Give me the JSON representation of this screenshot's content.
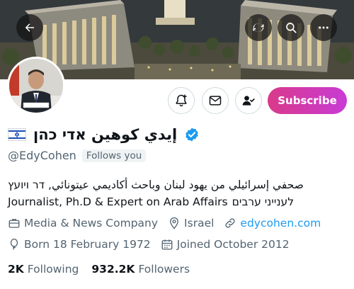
{
  "profile": {
    "display_name": "إيدي كوهين אדי כהן",
    "handle": "@EdyCohen",
    "follows_you": "Follows you",
    "bio_line1": "صحفي إسرائيلي من يهود لبنان وباحث أكاديمي عيتونائي, דר ויועץ",
    "bio_line2_en": "Journalist, Ph.D & Expert on Arab Affairs",
    "bio_line2_he": "לענייני ערבים",
    "category": "Media & News Company",
    "location": "Israel",
    "website": "edycohen.com",
    "birth": "Born 18 February 1972",
    "joined": "Joined October 2012",
    "following_count": "2K",
    "following_label": "Following",
    "followers_count": "932.2K",
    "followers_label": "Followers"
  },
  "actions": {
    "subscribe_label": "Subscribe"
  },
  "icons": {
    "back": "arrow-left-icon",
    "refresh": "refresh-icon",
    "search": "search-icon",
    "more": "more-icon",
    "notify": "bell-plus-icon",
    "message": "mail-icon",
    "following": "person-check-icon",
    "category": "briefcase-icon",
    "location": "location-pin-icon",
    "link": "link-icon",
    "birth": "balloon-icon",
    "joined": "calendar-icon",
    "verified": "verified-badge-icon",
    "flag": "israel-flag-icon"
  },
  "colors": {
    "accent_link": "#1d9bf0",
    "subscribe_gradient_start": "#d93a8a",
    "subscribe_gradient_end": "#c83bd6",
    "muted_text": "#536471"
  }
}
